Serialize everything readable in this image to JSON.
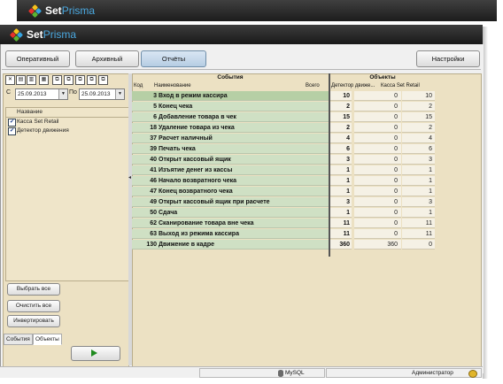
{
  "app": {
    "brand_bold": "Set",
    "brand_light": "Prisma"
  },
  "toolbar": {
    "tab_operative": "Оперативный",
    "tab_archive": "Архивный",
    "tab_reports": "Отчёты",
    "settings": "Настройки"
  },
  "filters": {
    "from_label": "С",
    "from_date": "25.09.2013",
    "to_label": "По",
    "to_date": "25.09.2013"
  },
  "object_list": {
    "header": "Название",
    "items": [
      {
        "label": "Касса  Set Retail",
        "checked": true
      },
      {
        "label": "Детектор движения",
        "checked": true
      }
    ]
  },
  "left_buttons": {
    "select_all": "Выбрать все",
    "clear_all": "Очистить все",
    "invert": "Инвертировать"
  },
  "left_tabs": {
    "events": "События",
    "objects": "Объекты"
  },
  "table": {
    "group_events": "События",
    "group_objects": "Объекты",
    "col_code": "Код",
    "col_name": "Наименование",
    "col_total": "Всего",
    "col_motion": "Детектор движе...",
    "col_cash": "Касса  Set Retail",
    "rows": [
      {
        "code": "3",
        "name": "Вход в режим кассира",
        "total": "10",
        "motion": "0",
        "cash": "10"
      },
      {
        "code": "5",
        "name": "Конец чека",
        "total": "2",
        "motion": "0",
        "cash": "2"
      },
      {
        "code": "6",
        "name": "Добавление товара в чек",
        "total": "15",
        "motion": "0",
        "cash": "15"
      },
      {
        "code": "18",
        "name": "Удаление товара из чека",
        "total": "2",
        "motion": "0",
        "cash": "2"
      },
      {
        "code": "37",
        "name": "Расчет наличный",
        "total": "4",
        "motion": "0",
        "cash": "4"
      },
      {
        "code": "39",
        "name": "Печать чека",
        "total": "6",
        "motion": "0",
        "cash": "6"
      },
      {
        "code": "40",
        "name": "Открыт кассовый ящик",
        "total": "3",
        "motion": "0",
        "cash": "3"
      },
      {
        "code": "41",
        "name": "Изъятие денег из кассы",
        "total": "1",
        "motion": "0",
        "cash": "1"
      },
      {
        "code": "46",
        "name": "Начало возвратного чека",
        "total": "1",
        "motion": "0",
        "cash": "1"
      },
      {
        "code": "47",
        "name": "Конец возвратного чека",
        "total": "1",
        "motion": "0",
        "cash": "1"
      },
      {
        "code": "49",
        "name": "Открыт кассовый ящик при расчете",
        "total": "3",
        "motion": "0",
        "cash": "3"
      },
      {
        "code": "50",
        "name": "Сдача",
        "total": "1",
        "motion": "0",
        "cash": "1"
      },
      {
        "code": "62",
        "name": "Сканирование товара вне чека",
        "total": "11",
        "motion": "0",
        "cash": "11"
      },
      {
        "code": "63",
        "name": "Выход из режима кассира",
        "total": "11",
        "motion": "0",
        "cash": "11"
      },
      {
        "code": "130",
        "name": "Движение в кадре",
        "total": "360",
        "motion": "360",
        "cash": "0"
      }
    ]
  },
  "status": {
    "db": "MySQL",
    "user": "Администратор"
  }
}
